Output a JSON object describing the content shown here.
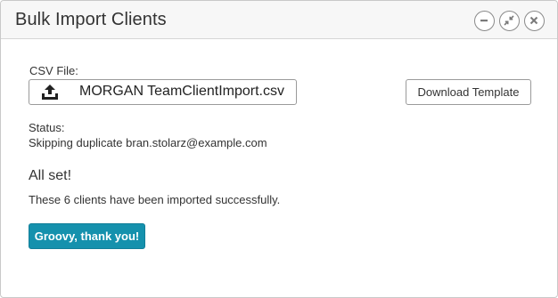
{
  "dialog": {
    "title": "Bulk Import Clients",
    "window_controls": {
      "minimize_icon": "minus-circle-icon",
      "restore_icon": "compress-arrows-icon",
      "close_icon": "x-circle-icon"
    }
  },
  "csv": {
    "label": "CSV File:",
    "icon": "upload-icon",
    "filename": "MORGAN TeamClientImport.csv"
  },
  "template_button_label": "Download Template",
  "status": {
    "label": "Status:",
    "text": "Skipping duplicate bran.stolarz@example.com"
  },
  "result": {
    "heading": "All set!",
    "message": "These 6 clients have been imported successfully."
  },
  "primary_button_label": "Groovy, thank you!",
  "colors": {
    "primary_button": "#1591ad",
    "titlebar_bg": "#f7f7f7",
    "border": "#c9c9c9"
  }
}
